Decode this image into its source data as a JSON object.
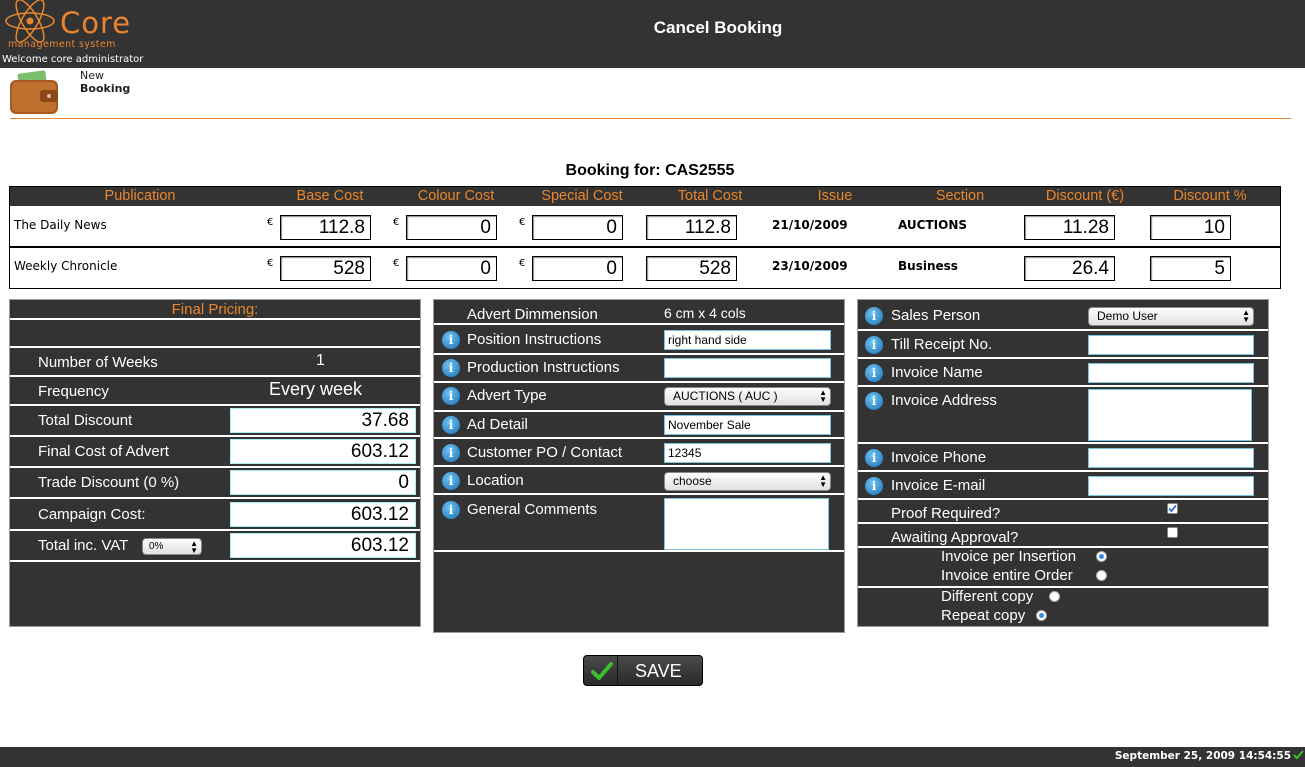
{
  "app": {
    "logo_word": "Core",
    "logo_sub": "management system",
    "welcome": "Welcome core administrator",
    "page_title": "Cancel Booking"
  },
  "shortcut": {
    "line1": "New",
    "line2": "Booking",
    "icon": "wallet-icon"
  },
  "booking_for": "Booking for: CAS2555",
  "table": {
    "headers": [
      "Publication",
      "Base Cost",
      "Colour Cost",
      "Special Cost",
      "Total Cost",
      "Issue",
      "Section",
      "Discount (€)",
      "Discount %"
    ],
    "currency": "€",
    "rows": [
      {
        "publication": "The Daily News",
        "base": "112.8",
        "colour": "0",
        "special": "0",
        "total": "112.8",
        "issue": "21/10/2009",
        "section": "AUCTIONS",
        "discount_eur": "11.28",
        "discount_pct": "10"
      },
      {
        "publication": "Weekly Chronicle",
        "base": "528",
        "colour": "0",
        "special": "0",
        "total": "528",
        "issue": "23/10/2009",
        "section": "Business",
        "discount_eur": "26.4",
        "discount_pct": "5"
      }
    ]
  },
  "pricing": {
    "title": "Final Pricing:",
    "weeks_label": "Number of Weeks",
    "weeks_value": "1",
    "frequency_label": "Frequency",
    "frequency_value": "Every week",
    "total_discount_label": "Total Discount",
    "total_discount_value": "37.68",
    "final_cost_label": "Final Cost of Advert",
    "final_cost_value": "603.12",
    "trade_discount_label": "Trade Discount (0 %)",
    "trade_discount_value": "0",
    "campaign_label": "Campaign Cost:",
    "campaign_value": "603.12",
    "vat_label": "Total inc. VAT",
    "vat_select": "0%",
    "vat_value": "603.12"
  },
  "advert": {
    "dimension_label": "Advert Dimmension",
    "dimension_value": "6 cm x 4 cols",
    "position_label": "Position Instructions",
    "position_value": "right hand side",
    "production_label": "Production Instructions",
    "production_value": "",
    "type_label": "Advert Type",
    "type_value": "AUCTIONS ( AUC )",
    "detail_label": "Ad Detail",
    "detail_value": "November Sale",
    "po_label": "Customer PO / Contact",
    "po_value": "12345",
    "location_label": "Location",
    "location_value": "choose",
    "comments_label": "General Comments",
    "comments_value": ""
  },
  "sales": {
    "person_label": "Sales Person",
    "person_value": "Demo User",
    "till_label": "Till Receipt No.",
    "till_value": "",
    "inv_name_label": "Invoice Name",
    "inv_name_value": "",
    "inv_addr_label": "Invoice Address",
    "inv_addr_value": "",
    "inv_phone_label": "Invoice Phone",
    "inv_phone_value": "",
    "inv_email_label": "Invoice E-mail",
    "inv_email_value": "",
    "proof_label": "Proof Required?",
    "proof_checked": true,
    "awaiting_label": "Awaiting Approval?",
    "awaiting_checked": false,
    "inv_per_insertion_label": "Invoice per Insertion",
    "inv_entire_label": "Invoice entire Order",
    "invoice_choice": "Invoice per Insertion",
    "diff_copy_label": "Different copy",
    "repeat_copy_label": "Repeat copy",
    "copy_choice": "Repeat copy"
  },
  "save_label": "SAVE",
  "footer_time": "September 25, 2009 14:54:55",
  "colors": {
    "accent": "#e9862d",
    "panel": "#333333",
    "info": "#1a6fb5"
  }
}
